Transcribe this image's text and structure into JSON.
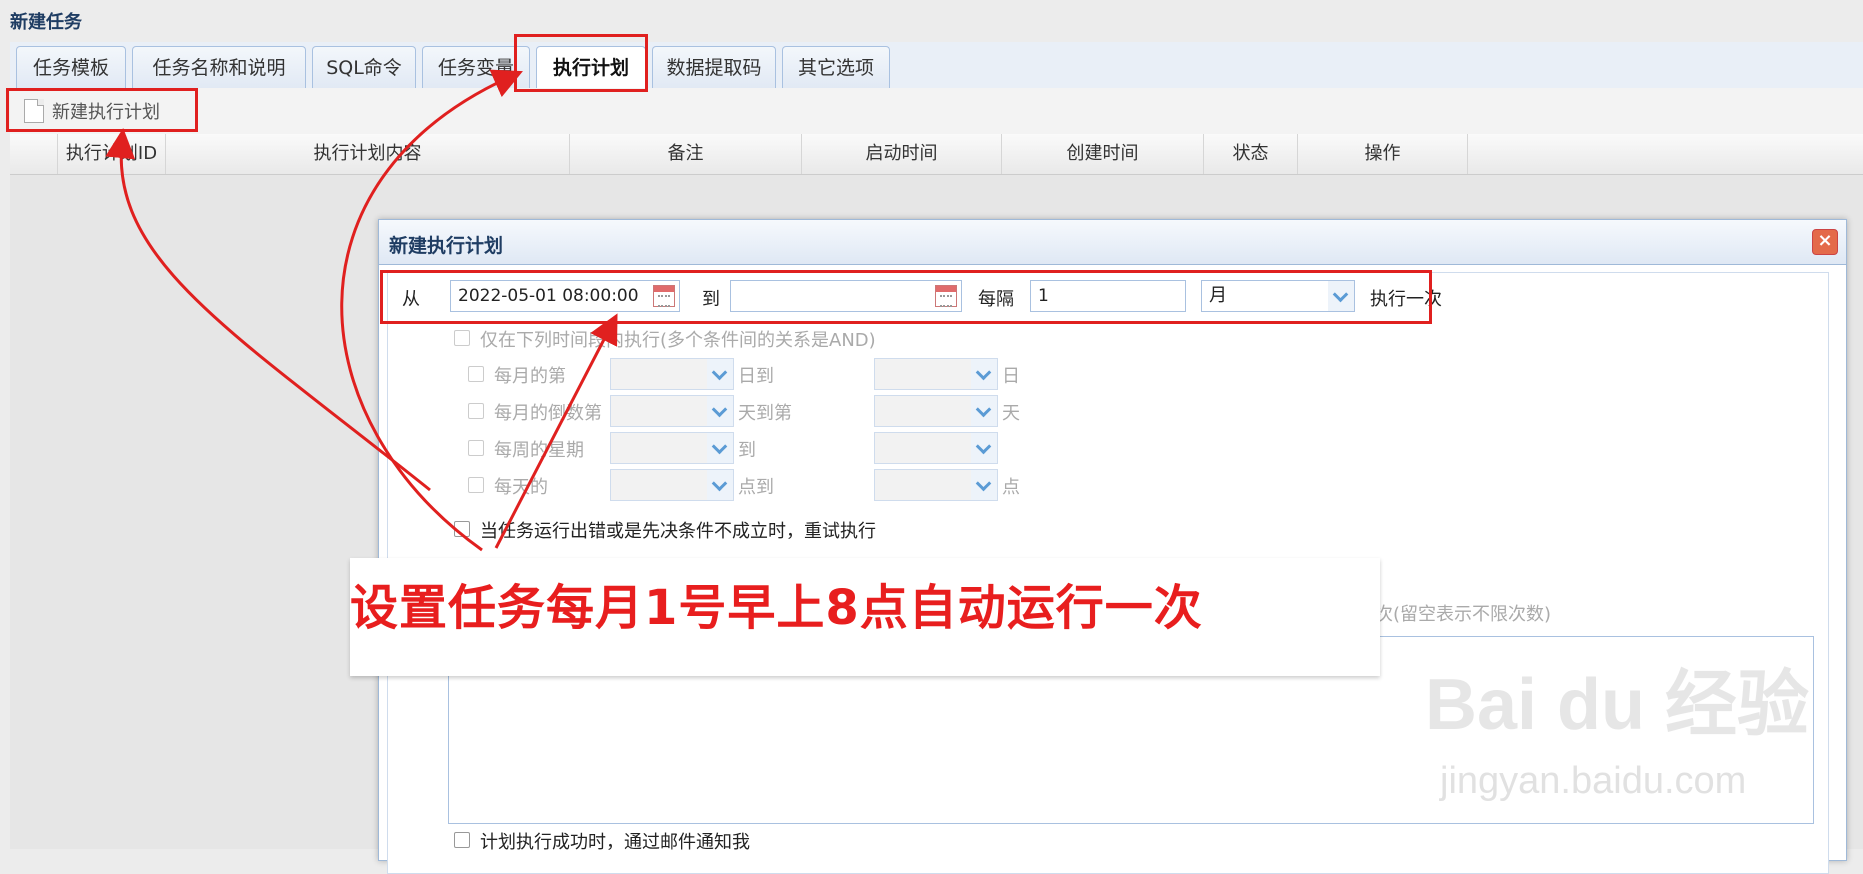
{
  "window": {
    "title": "新建任务"
  },
  "tabs": [
    "任务模板",
    "任务名称和说明",
    "SQL命令",
    "任务变量",
    "执行计划",
    "数据提取码",
    "其它选项"
  ],
  "active_tab": "执行计划",
  "toolbar": {
    "new_plan_label": "新建执行计划"
  },
  "grid": {
    "columns": [
      "执行计划ID",
      "执行计划内容",
      "备注",
      "启动时间",
      "创建时间",
      "状态",
      "操作"
    ]
  },
  "dialog": {
    "title": "新建执行计划",
    "from_label": "从",
    "from_value": "2022-05-01 08:00:00",
    "to_label": "到",
    "to_value": "",
    "every_label": "每隔",
    "every_value": "1",
    "unit_value": "月",
    "execute_once": "执行一次",
    "only_within": "仅在下列时间段内执行(多个条件间的关系是AND)",
    "rows": [
      {
        "label": "每月的第",
        "mid": "日到",
        "end": "日"
      },
      {
        "label": "每月的倒数第",
        "mid": "天到第",
        "end": "天"
      },
      {
        "label": "每周的星期",
        "mid": "到",
        "end": ""
      },
      {
        "label": "每天的",
        "mid": "点到",
        "end": "点"
      }
    ],
    "retry_label": "当任务运行出错或是先决条件不成立时，重试执行",
    "retry_limit_note": "次(留空表示不限次数)",
    "email_label": "计划执行成功时，通过邮件通知我"
  },
  "annotation": {
    "callout": "设置任务每月1号早上8点自动运行一次"
  },
  "watermark": {
    "brand": "Bai du 经验",
    "url": "jingyan.baidu.com"
  },
  "colors": {
    "annotation_red": "#e0201f",
    "accent_blue": "#5b9bd5",
    "title_blue": "#1f3d63"
  }
}
